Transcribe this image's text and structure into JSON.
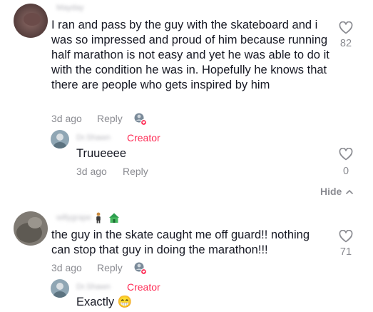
{
  "comments": [
    {
      "username": "Mayday",
      "text": "I ran and pass by the guy with the skateboard and i was so impressed and proud of him because running half marathon is not easy and yet he was able to do it with the condition he was in. Hopefully he knows that there are people who gets inspired by him",
      "time": "3d ago",
      "reply_label": "Reply",
      "likes": "82",
      "replies": [
        {
          "username": "Dr.Shawn",
          "badge": "Creator",
          "text": "Truueeee",
          "time": "3d ago",
          "reply_label": "Reply",
          "likes": "0"
        }
      ],
      "hide_label": "Hide"
    },
    {
      "username": "willygrape",
      "text": "the guy in the skate caught me off guard!! nothing can stop that guy in doing the marathon!!!",
      "time": "3d ago",
      "reply_label": "Reply",
      "likes": "71",
      "replies": [
        {
          "username": "Dr.Shawn",
          "badge": "Creator",
          "text": "Exactly 😁"
        }
      ]
    }
  ],
  "icons": {
    "like": "heart-outline-icon",
    "creator_liked": "creator-liked-avatar-icon",
    "hide": "chevron-up-icon"
  },
  "colors": {
    "creator": "#fe2c55",
    "meta": "#8a8b91",
    "text": "#161823"
  }
}
